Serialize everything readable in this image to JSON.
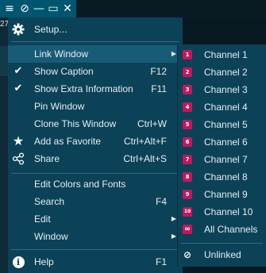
{
  "titlebar": {
    "icons": [
      "menu-icon",
      "unlink-icon",
      "minimize-icon",
      "maximize-icon",
      "close-icon"
    ],
    "glyphs": {
      "menu": "≡",
      "unlink": "⊘",
      "minimize": "—",
      "maximize": "▭",
      "close": "✕"
    }
  },
  "background": {
    "number": "27"
  },
  "menu": {
    "setup": {
      "label": "Setup..."
    },
    "link_window": {
      "label": "Link Window",
      "arrow": "▶"
    },
    "show_caption": {
      "label": "Show Caption",
      "shortcut": "F12",
      "check": "✔",
      "checked": true
    },
    "show_extra": {
      "label": "Show Extra Information",
      "shortcut": "F11",
      "check": "✔",
      "checked": true
    },
    "pin_window": {
      "label": "Pin Window"
    },
    "clone_window": {
      "label": "Clone This Window",
      "shortcut": "Ctrl+W"
    },
    "add_favorite": {
      "label": "Add as Favorite",
      "shortcut": "Ctrl+Alt+F",
      "icon": "★"
    },
    "share": {
      "label": "Share",
      "shortcut": "Ctrl+Alt+S",
      "icon": "⚭"
    },
    "edit_colors": {
      "label": "Edit Colors and Fonts"
    },
    "search": {
      "label": "Search",
      "shortcut": "F4"
    },
    "edit": {
      "label": "Edit",
      "arrow": "▶"
    },
    "window": {
      "label": "Window",
      "arrow": "▶"
    },
    "help": {
      "label": "Help",
      "shortcut": "F1",
      "icon": "i"
    }
  },
  "submenu": {
    "channels": [
      {
        "label": "Channel 1",
        "num": "1",
        "color": "#c2185b"
      },
      {
        "label": "Channel 2",
        "num": "2",
        "color": "#c2185b"
      },
      {
        "label": "Channel 3",
        "num": "3",
        "color": "#c2185b"
      },
      {
        "label": "Channel 4",
        "num": "4",
        "color": "#c2185b"
      },
      {
        "label": "Channel 5",
        "num": "5",
        "color": "#c2185b"
      },
      {
        "label": "Channel 6",
        "num": "6",
        "color": "#c2185b"
      },
      {
        "label": "Channel 7",
        "num": "7",
        "color": "#c2185b"
      },
      {
        "label": "Channel 8",
        "num": "8",
        "color": "#c2185b"
      },
      {
        "label": "Channel 9",
        "num": "9",
        "color": "#c2185b"
      },
      {
        "label": "Channel 10",
        "num": "10",
        "color": "#c2185b"
      }
    ],
    "all_channels": {
      "label": "All Channels",
      "icon": "∞",
      "color": "#c2185b"
    },
    "unlinked": {
      "label": "Unlinked",
      "icon": "⊘"
    }
  }
}
